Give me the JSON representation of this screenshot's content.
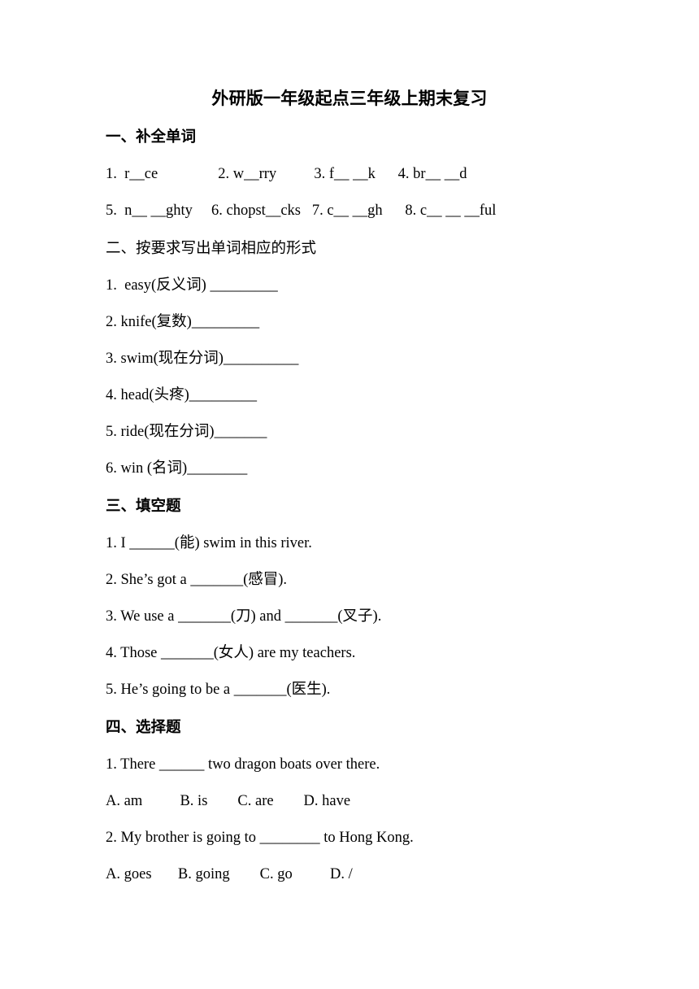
{
  "document": {
    "title": "外研版一年级起点三年级上期末复习"
  },
  "sections": [
    {
      "heading": "一、补全单词",
      "bold": true,
      "lines": [
        "1.  r__ce                2. w__rry          3. f__ __k      4. br__ __d",
        "5.  n__ __ghty     6. chopst__cks   7. c__ __gh      8. c__ __ __ful"
      ]
    },
    {
      "heading": "二、按要求写出单词相应的形式",
      "bold": false,
      "lines": [
        "1.  easy(反义词) _________",
        "2. knife(复数)_________",
        "3. swim(现在分词)__________",
        "4. head(头疼)_________",
        "5. ride(现在分词)_______",
        "6. win (名词)________"
      ]
    },
    {
      "heading": "三、填空题",
      "bold": true,
      "lines": [
        "1. I ______(能) swim in this river.",
        "2. She’s got a _______(感冒).",
        "3. We use a _______(刀) and _______(叉子).",
        "4. Those _______(女人) are my teachers.",
        "5. He’s going to be a _______(医生)."
      ]
    },
    {
      "heading": "四、选择题",
      "bold": true,
      "lines": [
        "1. There ______ two dragon boats over there.",
        "A. am          B. is        C. are        D. have",
        "2. My brother is going to ________ to Hong Kong.",
        "A. goes       B. going        C. go          D. /"
      ]
    }
  ]
}
